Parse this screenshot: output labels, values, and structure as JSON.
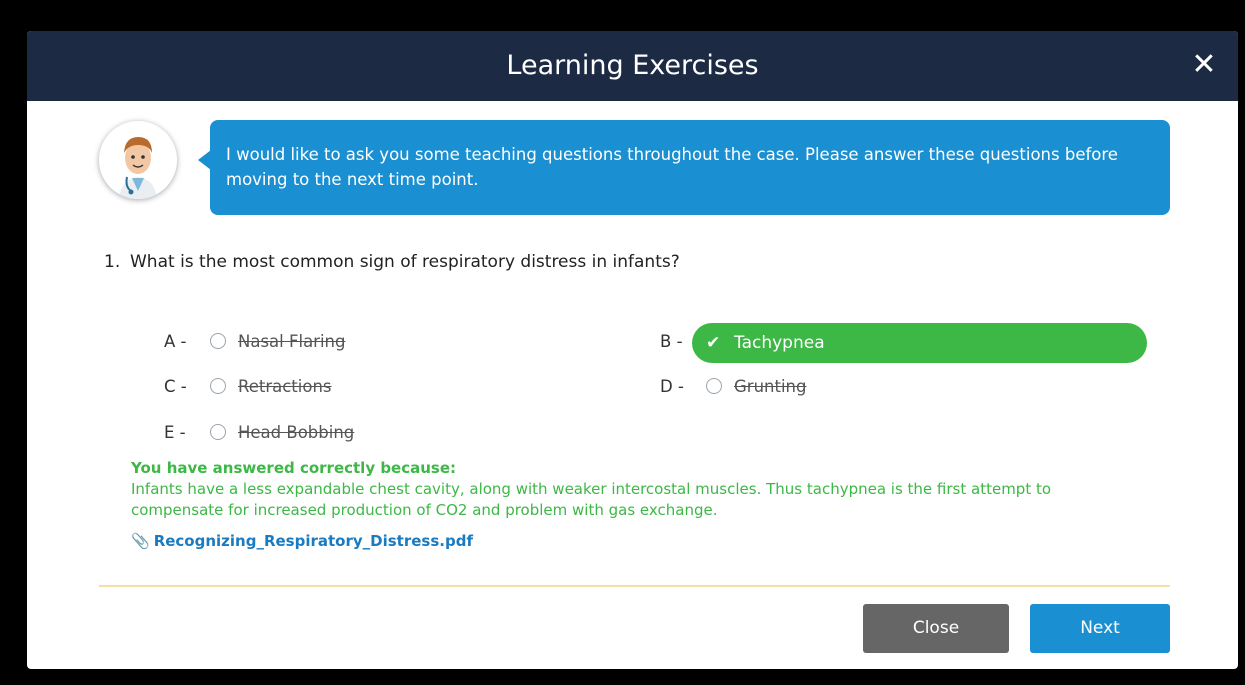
{
  "header": {
    "title": "Learning Exercises",
    "close_symbol": "✕"
  },
  "bubble": {
    "text": "I would like to ask you some teaching questions throughout the case. Please answer these questions before moving to the next time point."
  },
  "question": {
    "number": "1.",
    "text": "What is the most common sign of respiratory distress in infants?"
  },
  "options": [
    {
      "letter": "A -",
      "label": "Nasal Flaring",
      "state": "eliminated"
    },
    {
      "letter": "B -",
      "label": "Tachypnea",
      "state": "correct"
    },
    {
      "letter": "C -",
      "label": "Retractions",
      "state": "eliminated"
    },
    {
      "letter": "D -",
      "label": "Grunting",
      "state": "eliminated"
    },
    {
      "letter": "E -",
      "label": "Head Bobbing",
      "state": "eliminated"
    }
  ],
  "feedback": {
    "heading": "You have answered correctly because:",
    "text": "Infants have a less expandable chest cavity, along with weaker intercostal muscles. Thus tachypnea is the first attempt to compensate for increased production of CO2 and problem with gas exchange."
  },
  "attachment": {
    "filename": "Recognizing_Respiratory_Distress.pdf",
    "icon": "paperclip-icon"
  },
  "buttons": {
    "close": "Close",
    "next": "Next"
  },
  "colors": {
    "header": "#1c2a44",
    "accent": "#1a8fd1",
    "correct": "#3db846",
    "close_button": "#666666",
    "divider": "#f4dfa6"
  }
}
